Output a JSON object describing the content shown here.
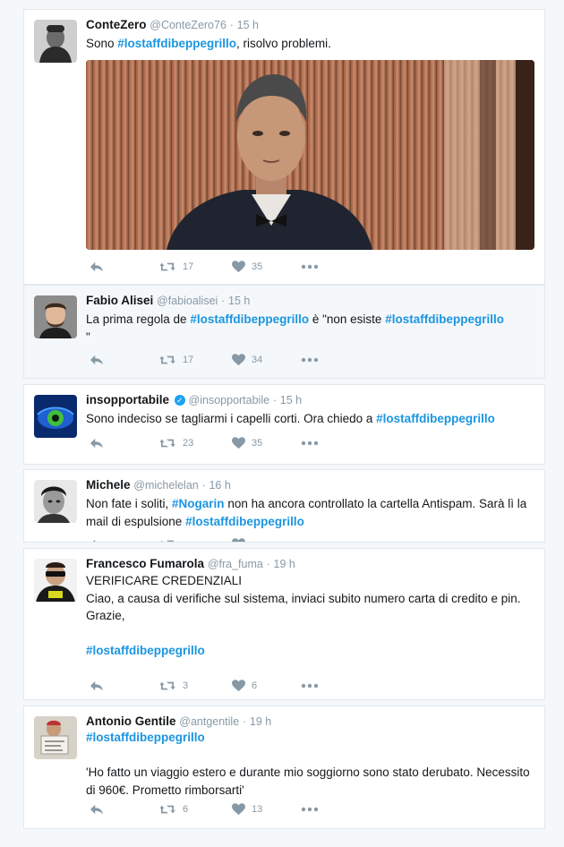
{
  "tweets": [
    {
      "name": "ConteZero",
      "handle": "@ConteZero76",
      "time": "15 h",
      "text_before": "Sono ",
      "hashtag": "#lostaffdibeppegrillo",
      "text_after": ", risolvo problemi.",
      "retweets": "17",
      "likes": "35"
    },
    {
      "name": "Fabio Alisei",
      "handle": "@fabioalisei",
      "time": "15 h",
      "text_1": "La prima regola de ",
      "hashtag_1": "#lostaffdibeppegrillo",
      "text_2": " è \"non esiste ",
      "hashtag_2": "#lostaffdibeppegrillo",
      "text_3": "\"",
      "retweets": "17",
      "likes": "34"
    },
    {
      "name": "insopportabile",
      "handle": "@insopportabile",
      "time": "15 h",
      "text_before": "Sono indeciso se tagliarmi i capelli corti. Ora chiedo a ",
      "hashtag": "#lostaffdibeppegrillo",
      "retweets": "23",
      "likes": "35"
    },
    {
      "name": "Michele",
      "handle": "@michelelan",
      "time": "16 h",
      "text_1": "Non fate i soliti, ",
      "hashtag_1": "#Nogarin",
      "text_2": " non ha ancora controllato la cartella Antispam. Sarà lì la mail di espulsione ",
      "hashtag_2": "#lostaffdibeppegrillo"
    },
    {
      "name": "Francesco Fumarola",
      "handle": "@fra_fuma",
      "time": "19 h",
      "line_1": "VERIFICARE CREDENZIALI",
      "line_2": "Ciao, a causa di verifiche sul sistema, inviaci subito numero carta di credito e pin.",
      "line_3": "Grazie,",
      "hashtag": "#lostaffdibeppegrillo",
      "retweets": "3",
      "likes": "6"
    },
    {
      "name": "Antonio Gentile",
      "handle": "@antgentile",
      "time": "19 h",
      "hashtag": "#lostaffdibeppegrillo",
      "quote": "'Ho fatto un viaggio estero e durante mio soggiorno sono stato derubato. Necessito di 960€. Prometto rimborsarti'",
      "retweets": "6",
      "likes": "13"
    }
  ],
  "dot": "·",
  "icons": {
    "reply": "reply-icon",
    "retweet": "retweet-icon",
    "like": "heart-icon",
    "more": "more-icon",
    "verified": "verified-badge-icon"
  },
  "colors": {
    "hashtag": "#1b95e0",
    "meta": "#8899a6",
    "verified": "#1da1f2"
  }
}
